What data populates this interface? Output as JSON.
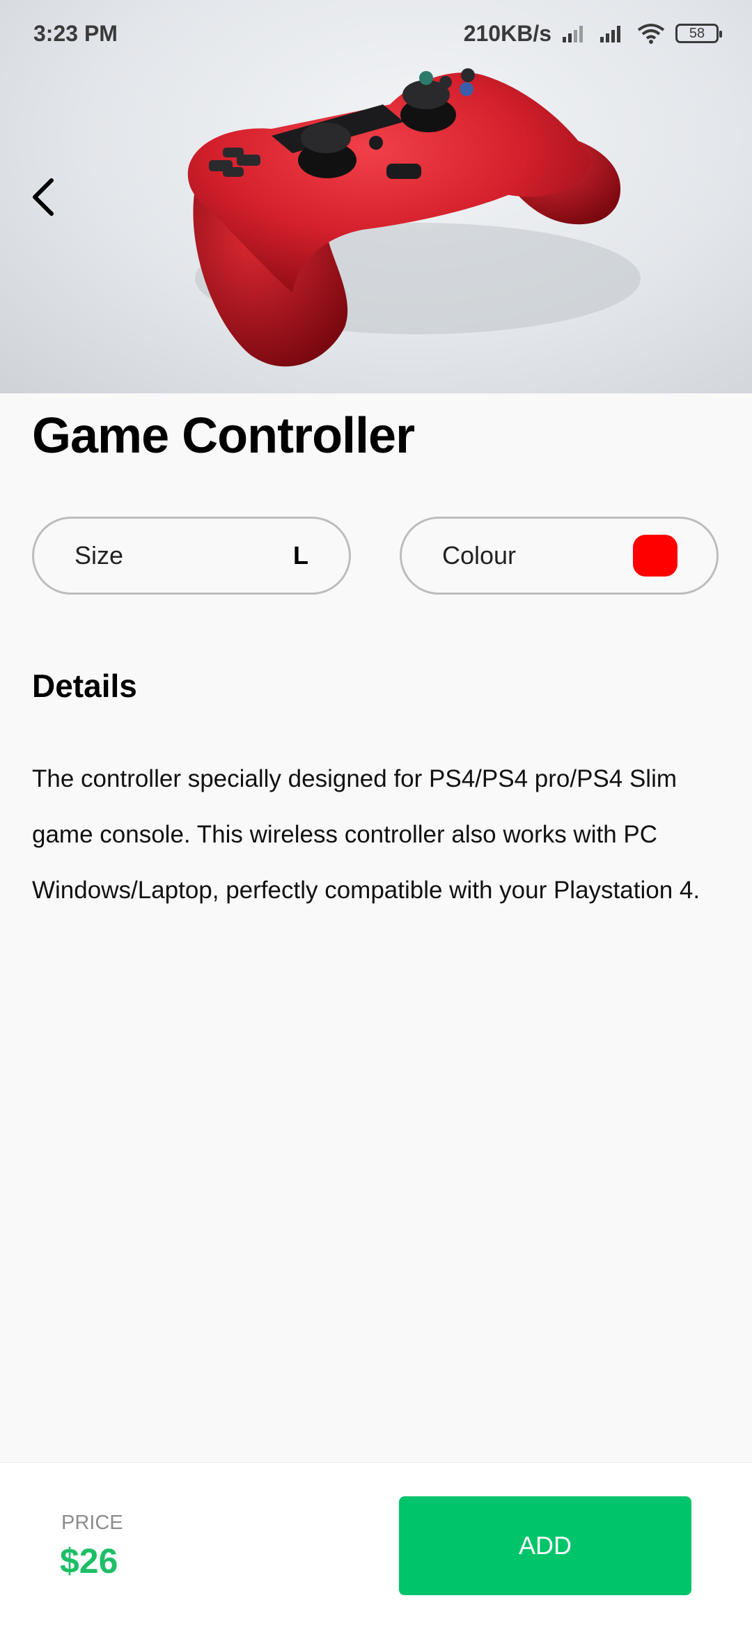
{
  "status_bar": {
    "time": "3:23 PM",
    "network_speed": "210KB/s",
    "battery": "58",
    "icons": [
      "signal-icon",
      "signal-icon",
      "wifi-icon",
      "battery-icon"
    ]
  },
  "product": {
    "image_icon": "game-controller-image",
    "title": "Game Controller",
    "size_label": "Size",
    "size_value": "L",
    "colour_label": "Colour",
    "colour_value": "#ff0000",
    "details_heading": "Details",
    "details_text": "The controller specially designed for PS4/PS4 pro/PS4 Slim game console. This wireless controller also works with PC Windows/Laptop, perfectly compatible with your Playstation 4."
  },
  "footer": {
    "price_label": "PRICE",
    "price_value": "$26",
    "add_label": "ADD"
  },
  "colors": {
    "accent": "#00c46a",
    "price": "#1dbf66"
  }
}
